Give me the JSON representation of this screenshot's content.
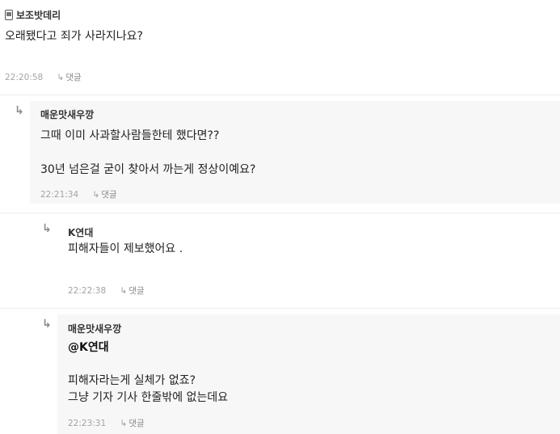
{
  "comments": [
    {
      "author": "보조밧데리",
      "author_icon": "phone-icon",
      "body": "오래됐다고 죄가 사라지나요?",
      "time": "22:20:58",
      "reply_label": "댓글"
    },
    {
      "author": "매운맛새우깡",
      "body": "그때 이미 사과할사람들한테 했다면??\n\n30년 넘은걸 굳이 찾아서 까는게 정상이예요?",
      "time": "22:21:34",
      "reply_label": "댓글"
    },
    {
      "author": "K연대",
      "body": "피해자들이 제보했어요 .",
      "time": "22:22:38",
      "reply_label": "댓글"
    },
    {
      "author": "매운맛새우깡",
      "mention": "@K연대",
      "body": "피해자라는게 실체가 없죠?\n그냥 기자 기사 한줄밖에 없는데요",
      "time": "22:23:31",
      "reply_label": "댓글"
    }
  ],
  "glyphs": {
    "indent_arrow": "↳",
    "reply_arrow": "↳"
  }
}
